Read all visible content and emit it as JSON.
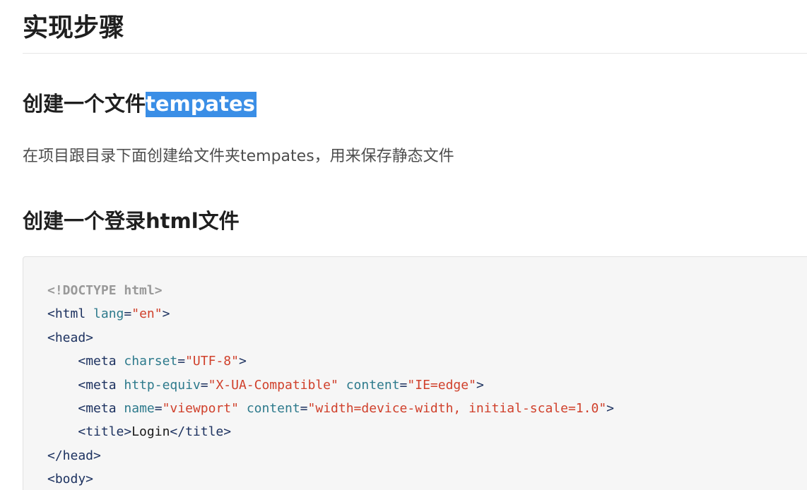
{
  "heading_main": "实现步骤",
  "section1": {
    "title_prefix": "创建一个文件",
    "title_selected": "tempates",
    "paragraph": "在项目跟目录下面创建给文件夹tempates，用来保存静态文件"
  },
  "section2": {
    "title": "创建一个登录html文件"
  },
  "code_lines": [
    [
      {
        "t": "doctype",
        "v": "<!DOCTYPE html>"
      }
    ],
    [
      {
        "t": "tag",
        "v": "<html "
      },
      {
        "t": "attr",
        "v": "lang"
      },
      {
        "t": "tag",
        "v": "="
      },
      {
        "t": "str",
        "v": "\"en\""
      },
      {
        "t": "tag",
        "v": ">"
      }
    ],
    [
      {
        "t": "tag",
        "v": "<head>"
      }
    ],
    [
      {
        "t": "txt",
        "v": "    "
      },
      {
        "t": "tag",
        "v": "<meta "
      },
      {
        "t": "attr",
        "v": "charset"
      },
      {
        "t": "tag",
        "v": "="
      },
      {
        "t": "str",
        "v": "\"UTF-8\""
      },
      {
        "t": "tag",
        "v": ">"
      }
    ],
    [
      {
        "t": "txt",
        "v": "    "
      },
      {
        "t": "tag",
        "v": "<meta "
      },
      {
        "t": "attr",
        "v": "http-equiv"
      },
      {
        "t": "tag",
        "v": "="
      },
      {
        "t": "str",
        "v": "\"X-UA-Compatible\""
      },
      {
        "t": "txt",
        "v": " "
      },
      {
        "t": "attr",
        "v": "content"
      },
      {
        "t": "tag",
        "v": "="
      },
      {
        "t": "str",
        "v": "\"IE=edge\""
      },
      {
        "t": "tag",
        "v": ">"
      }
    ],
    [
      {
        "t": "txt",
        "v": "    "
      },
      {
        "t": "tag",
        "v": "<meta "
      },
      {
        "t": "attr",
        "v": "name"
      },
      {
        "t": "tag",
        "v": "="
      },
      {
        "t": "str",
        "v": "\"viewport\""
      },
      {
        "t": "txt",
        "v": " "
      },
      {
        "t": "attr",
        "v": "content"
      },
      {
        "t": "tag",
        "v": "="
      },
      {
        "t": "str",
        "v": "\"width=device-width, initial-scale=1.0\""
      },
      {
        "t": "tag",
        "v": ">"
      }
    ],
    [
      {
        "t": "txt",
        "v": "    "
      },
      {
        "t": "tag",
        "v": "<title>"
      },
      {
        "t": "txt",
        "v": "Login"
      },
      {
        "t": "tag",
        "v": "</title>"
      }
    ],
    [
      {
        "t": "tag",
        "v": "</head>"
      }
    ],
    [
      {
        "t": "tag",
        "v": "<body>"
      }
    ]
  ]
}
